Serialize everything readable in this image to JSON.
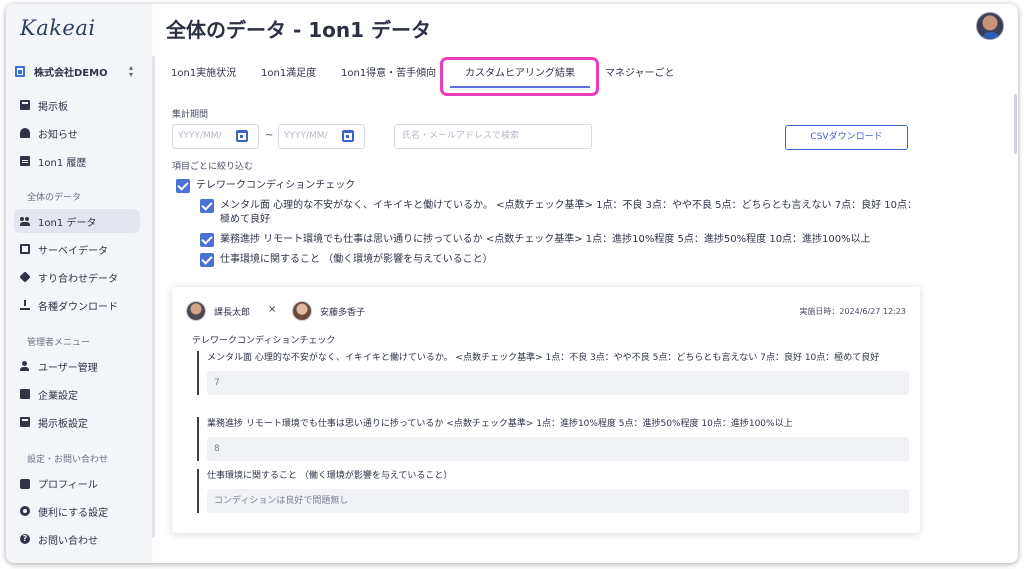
{
  "app": {
    "logo": "Kakeai",
    "company": "株式会社DEMO"
  },
  "sidebar": {
    "items": [
      {
        "label": "掲示板"
      },
      {
        "label": "お知らせ"
      },
      {
        "label": "1on1 履歴"
      },
      {
        "label": "1on1 データ"
      },
      {
        "label": "サーベイデータ"
      },
      {
        "label": "すり合わせデータ"
      },
      {
        "label": "各種ダウンロード"
      },
      {
        "label": "ユーザー管理"
      },
      {
        "label": "企業設定"
      },
      {
        "label": "掲示板設定"
      },
      {
        "label": "プロフィール"
      },
      {
        "label": "便利にする設定"
      },
      {
        "label": "お問い合わせ"
      }
    ],
    "sections": [
      "全体のデータ",
      "管理者メニュー",
      "設定・お問い合わせ"
    ],
    "active_index": 3
  },
  "header": {
    "title": "全体のデータ - 1on1 データ"
  },
  "tabs": [
    {
      "label": "1on1実施状況"
    },
    {
      "label": "1on1満足度"
    },
    {
      "label": "1on1得意・苦手傾向"
    },
    {
      "label": "カスタムヒアリング結果"
    },
    {
      "label": "マネジャーごと"
    }
  ],
  "filters": {
    "period_label": "集計期間",
    "date_placeholder": "YYYY/MM/",
    "tilde": "~",
    "search_placeholder": "氏名・メールアドレスで検索",
    "csv_button": "CSVダウンロード",
    "narrow_label": "項目ごとに絞り込む",
    "group": "テレワークコンディションチェック",
    "items": [
      "メンタル面 心理的な不安がなく、イキイキと働けているか。 <点数チェック基準> 1点：不良 3点：やや不良 5点：どちらとも言えない 7点：良好 10点：極めて良好",
      "業務進捗 リモート環境でも仕事は思い通りに捗っているか <点数チェック基準> 1点：進捗10%程度 5点：進捗50%程度 10点：進捗100%以上",
      "仕事環境に関すること （働く環境が影響を与えていること）"
    ]
  },
  "card": {
    "manager": "課長太郎",
    "times": "×",
    "member": "安藤多香子",
    "date": "実施日時：2024/6/27 12:23",
    "group": "テレワークコンディションチェック",
    "answers": [
      {
        "question": "メンタル面 心理的な不安がなく、イキイキと働けているか。 <点数チェック基準> 1点：不良 3点：やや不良 5点：どちらとも言えない 7点：良好 10点：極めて良好",
        "value": "7"
      },
      {
        "question": "業務進捗 リモート環境でも仕事は思い通りに捗っているか <点数チェック基準> 1点：進捗10%程度 5点：進捗50%程度 10点：進捗100%以上",
        "value": "8"
      },
      {
        "question": "仕事環境に関すること （働く環境が影響を与えていること）",
        "value": "コンディションは良好で問題無し"
      }
    ]
  },
  "colors": {
    "accent": "#4a72d6",
    "highlight": "#ea3bb8",
    "sidebar_bg": "#f4f5f9"
  }
}
